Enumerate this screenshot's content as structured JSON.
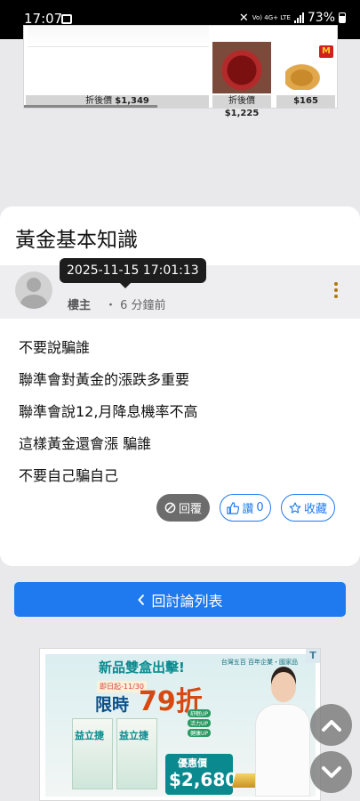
{
  "status_bar": {
    "time": "17:07",
    "network": "Vo) 4G+ LTE",
    "battery": "73%"
  },
  "top_ad": {
    "prices": [
      {
        "label": "折後價",
        "value": "$1,349"
      },
      {
        "label": "折後價",
        "value": "$1,225"
      },
      {
        "label": "",
        "value": "$165"
      }
    ]
  },
  "post": {
    "title": "黃金基本知識",
    "author": "樓主",
    "separator": "・",
    "relative_time": "6 分鐘前",
    "tooltip_datetime": "2025-11-15 17:01:13",
    "lines": [
      "不要說騙誰",
      "聯準會對黃金的漲跌多重要",
      "聯準會說12,月降息機率不高",
      "這樣黃金還會漲 騙誰",
      "不要自己騙自己"
    ],
    "actions": {
      "reply_label": "回覆",
      "like_label": "讚",
      "like_count": "0",
      "favorite_label": "收藏"
    }
  },
  "back_button": {
    "label": "回討論列表",
    "icon": "chevron-left-icon"
  },
  "bottom_ad": {
    "badge": "T",
    "brand": "台灣五百 百年企業・國家品",
    "headline": "新品雙盒出擊!",
    "dates": "即日起-11/30",
    "limit": "限時",
    "discount": "79折",
    "tags": [
      "舒眠UP",
      "活力UP",
      "健康UP"
    ],
    "product_name": "益立捷",
    "offer_label": "優惠價",
    "offer_value": "$2,680"
  },
  "colors": {
    "accent_blue": "#1f7aef",
    "reply_gray": "#6c6c6c",
    "page_bg": "#e9e9ec",
    "tooltip_bg": "#1d1d1d",
    "more_icon": "#b07800"
  }
}
